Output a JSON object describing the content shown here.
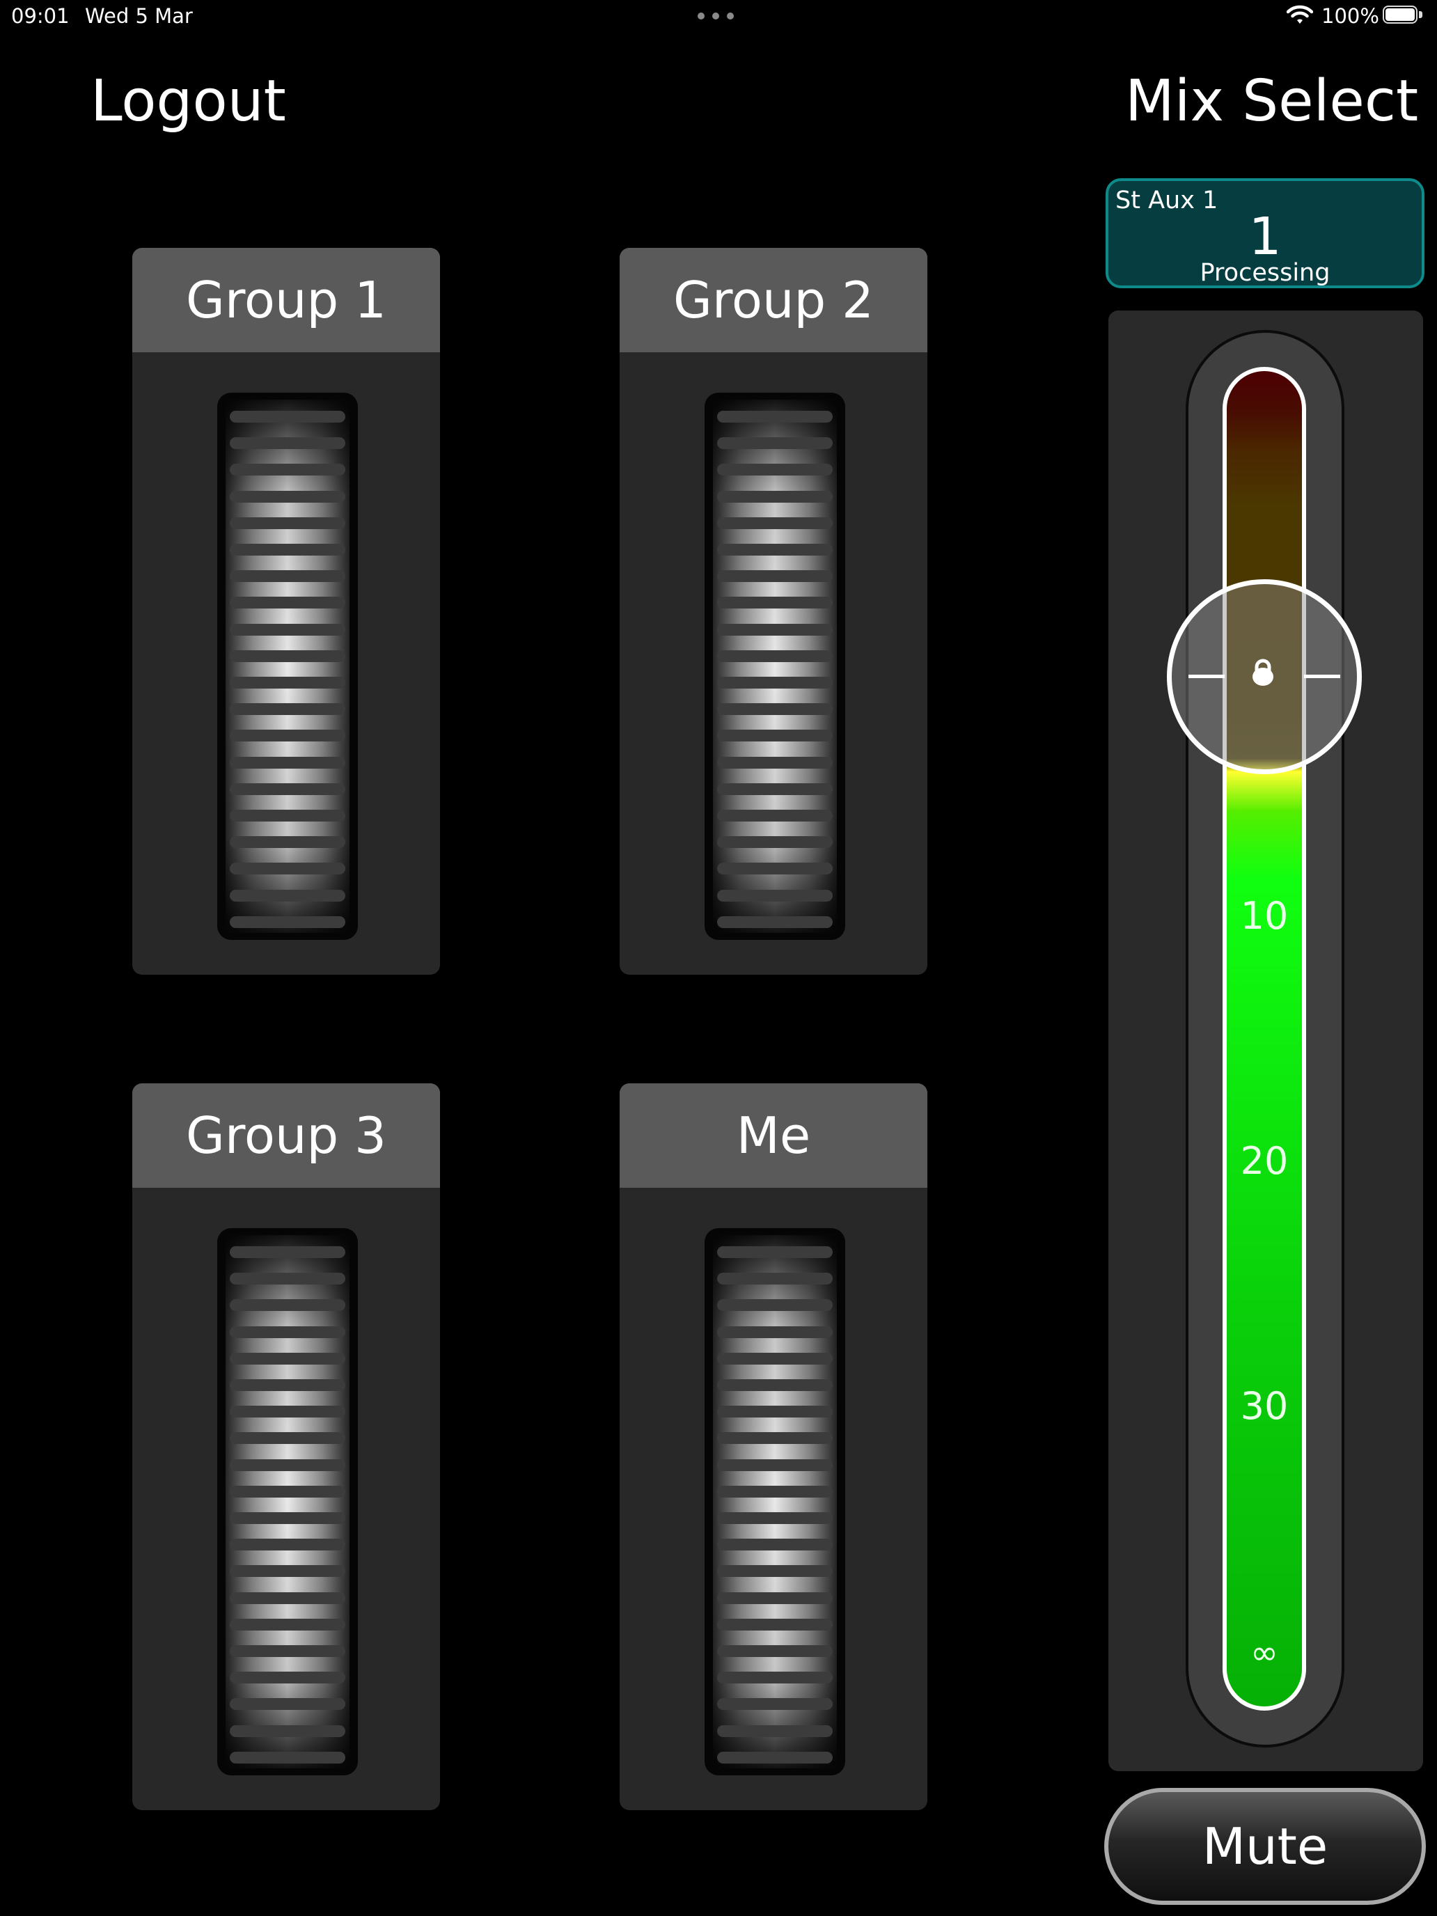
{
  "status_bar": {
    "time": "09:01",
    "date": "Wed 5 Mar",
    "battery": "100%"
  },
  "header": {
    "logout_label": "Logout",
    "mix_select_label": "Mix Select"
  },
  "groups": [
    {
      "label": "Group 1"
    },
    {
      "label": "Group 2"
    },
    {
      "label": "Group 3"
    },
    {
      "label": "Me"
    }
  ],
  "mix": {
    "name": "St Aux 1",
    "number": "1",
    "mode": "Processing"
  },
  "fader": {
    "scale_labels": [
      "10",
      "20",
      "30",
      "∞"
    ],
    "colors": {
      "top": "#4d0002",
      "upper": "#4a3a00",
      "peak": "#ffff30",
      "green": "#10ff10",
      "green_low": "#06b006"
    }
  },
  "mute_label": "Mute",
  "accent_color": "#0f8a8a"
}
